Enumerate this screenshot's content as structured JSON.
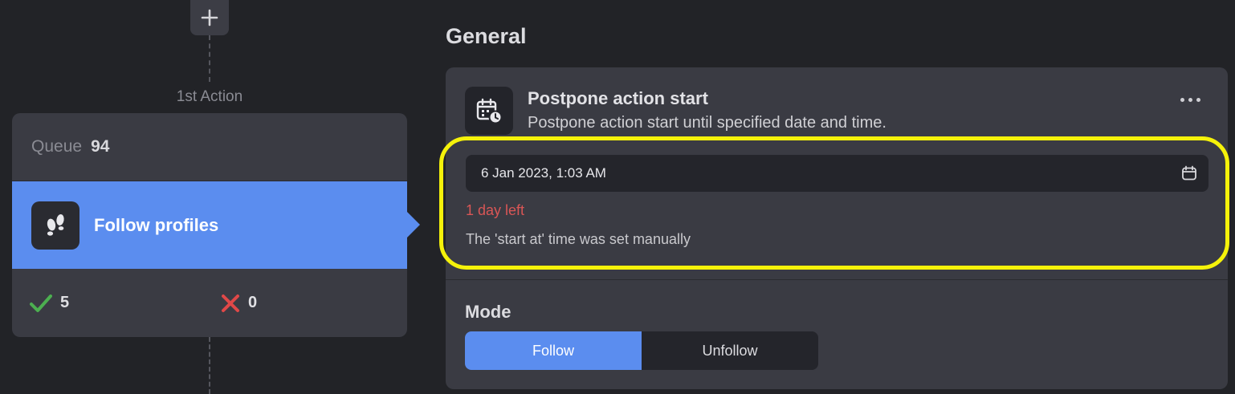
{
  "flow": {
    "add_icon": "plus-icon",
    "action_label": "1st Action"
  },
  "action_card": {
    "queue_label": "Queue",
    "queue_value": "94",
    "task_title": "Follow profiles",
    "task_icon": "footsteps-icon",
    "success_count": "5",
    "fail_count": "0",
    "colors": {
      "accent": "#5b8def",
      "success": "#4caf50",
      "fail": "#e04848"
    }
  },
  "general": {
    "section_title": "General",
    "setting": {
      "icon": "calendar-clock-icon",
      "title": "Postpone action start",
      "description": "Postpone action start until specified date and time.",
      "more_icon": "more-horizontal-icon"
    },
    "date_value": "6 Jan 2023, 1:03 AM",
    "date_icon": "calendar-icon",
    "days_left": "1 day left",
    "note": "The 'start at' time was set manually",
    "highlight_color": "#f5f20a"
  },
  "mode": {
    "label": "Mode",
    "options": [
      "Follow",
      "Unfollow"
    ],
    "selected": "Follow"
  }
}
